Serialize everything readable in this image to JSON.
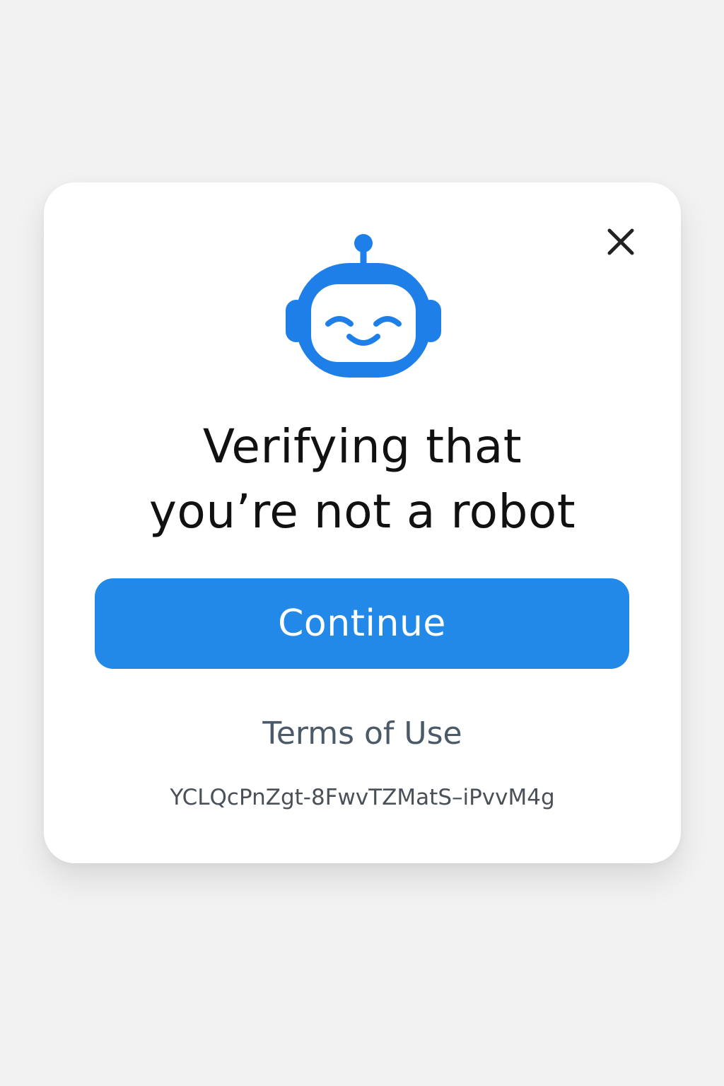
{
  "dialog": {
    "title_line1": "Verifying that",
    "title_line2": "you’re not a robot",
    "continue_label": "Continue",
    "terms_label": "Terms of Use",
    "verification_code": "YCLQcPnZgt-8FwvTZMatS–iPvvM4g",
    "icons": {
      "close": "close-icon",
      "robot": "robot-icon"
    },
    "colors": {
      "accent": "#2289e8",
      "robot": "#1f7fe8",
      "title": "#111111",
      "terms": "#4a5a68"
    }
  }
}
